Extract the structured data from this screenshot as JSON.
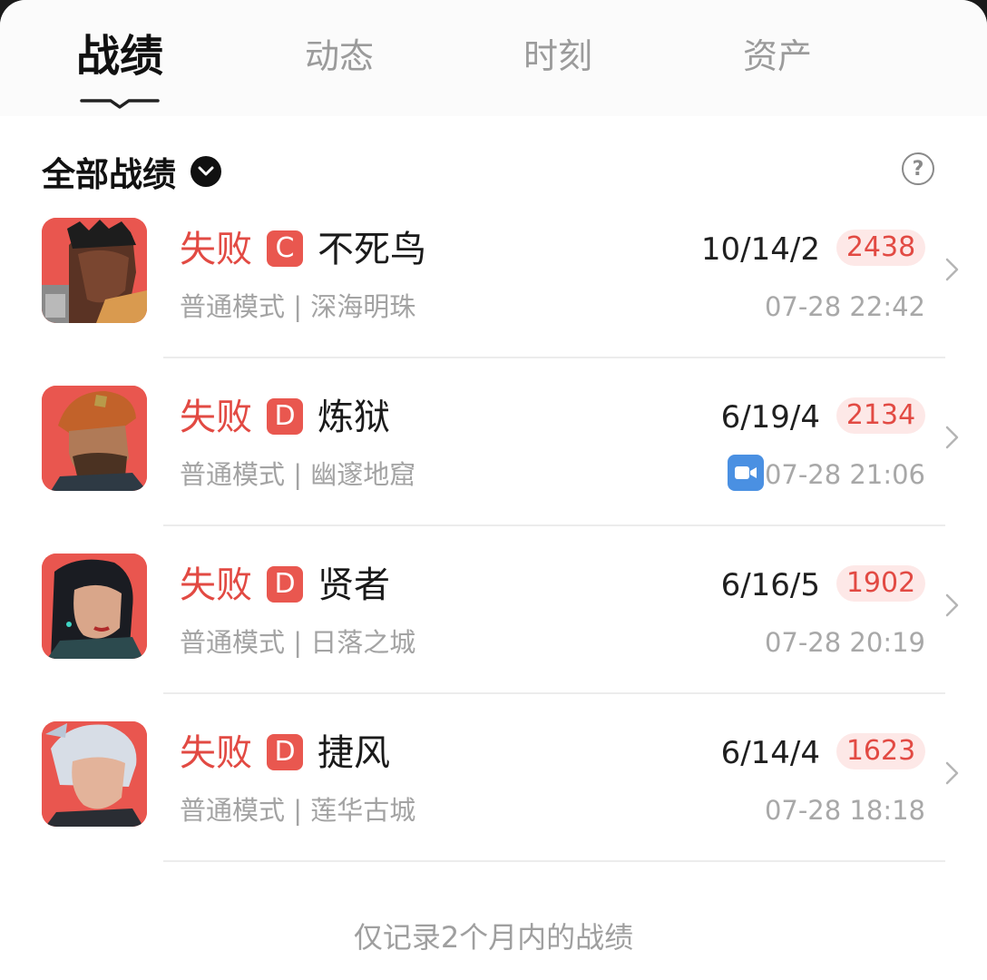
{
  "tabs": [
    {
      "label": "战绩",
      "active": true
    },
    {
      "label": "动态",
      "active": false
    },
    {
      "label": "时刻",
      "active": false
    },
    {
      "label": "资产",
      "active": false
    }
  ],
  "filter": {
    "label": "全部战绩",
    "icon": "chevron-down-icon"
  },
  "help_icon": "question-icon",
  "matches": [
    {
      "result": "失败",
      "grade": "C",
      "hero": "不死鸟",
      "kda": "10/14/2",
      "score": "2438",
      "mode_map": "普通模式 | 深海明珠",
      "time": "07-28 22:42",
      "has_video": false
    },
    {
      "result": "失败",
      "grade": "D",
      "hero": "炼狱",
      "kda": "6/19/4",
      "score": "2134",
      "mode_map": "普通模式 | 幽邃地窟",
      "time": "07-28 21:06",
      "has_video": true
    },
    {
      "result": "失败",
      "grade": "D",
      "hero": "贤者",
      "kda": "6/16/5",
      "score": "1902",
      "mode_map": "普通模式 | 日落之城",
      "time": "07-28 20:19",
      "has_video": false
    },
    {
      "result": "失败",
      "grade": "D",
      "hero": "捷风",
      "kda": "6/14/4",
      "score": "1623",
      "mode_map": "普通模式 | 莲华古城",
      "time": "07-28 18:18",
      "has_video": false
    }
  ],
  "footnote": "仅记录2个月内的战绩",
  "colors": {
    "accent": "#e24a43",
    "score_bg": "#fde8e7",
    "video": "#4a90e2"
  }
}
